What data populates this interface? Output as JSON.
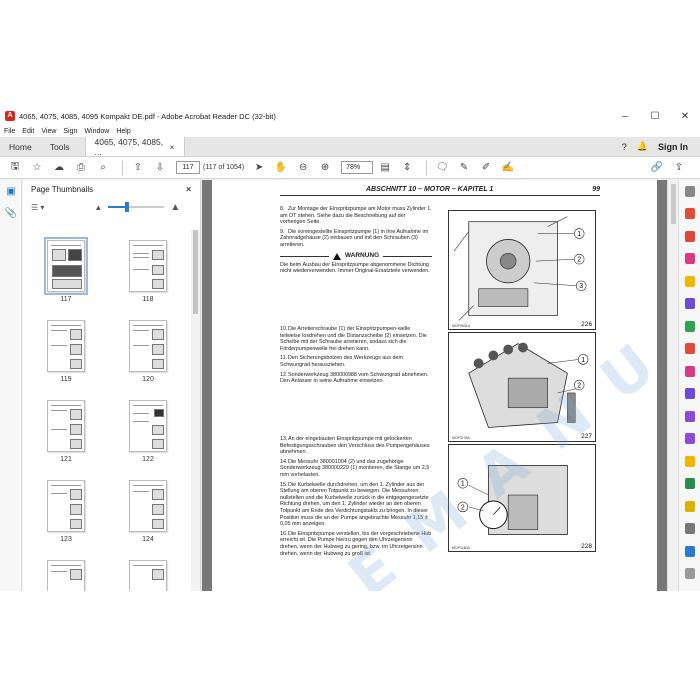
{
  "window": {
    "title": "4065, 4075, 4085, 4095 Kompakt DE.pdf - Adobe Acrobat Reader DC (32-bit)",
    "minimize": "–",
    "maximize": "☐",
    "close": "✕"
  },
  "menu": [
    "File",
    "Edit",
    "View",
    "Sign",
    "Window",
    "Help"
  ],
  "tabs": {
    "home": "Home",
    "tools": "Tools",
    "document": "4065, 4075, 4085, ...",
    "document_close": "×",
    "signin": "Sign In"
  },
  "toolbar": {
    "current_page": "117",
    "page_count": "(117 of 1054)",
    "zoom": "78%"
  },
  "thumbnails_panel": {
    "title": "Page Thumbnails",
    "close": "✕",
    "slider_level": 0.33,
    "pages": [
      "117",
      "118",
      "119",
      "120",
      "121",
      "122",
      "123",
      "124"
    ]
  },
  "document": {
    "header": "ABSCHNITT 10 – MOTOR – KAPITEL 1",
    "page_number": "99",
    "paragraphs_group1": [
      {
        "n": "8.",
        "text": "Zur Montage der Einspritzpumpe am Motor muss Zylinder 1 am OT stehen. Siehe dazu die Beschreibung auf der vorherigen Seite."
      },
      {
        "n": "9.",
        "text": "Die voreingestellte Einspritzpumpe (1) in ihre Aufnahme im Zahnradgehäuse (2) einbauen und mit den Schrauben (3) arretieren."
      }
    ],
    "warning_title": "WARNUNG",
    "warning_text": "Die beim Ausbau der Einspritzpumpe abgenommene Dichtung nicht wiederverwenden. Immer Original-Ersatzteile verwenden.",
    "paragraphs_group2": [
      {
        "n": "10.",
        "text": "Die Arretierschraube (1) der Einspritzpumpen-welle teilweise losdrehen und die Distanzscheibe (2) einsetzen. Die Scheibe mit der Schraube arretieren, sodass sich die Förderpumpenwelle frei drehen kann."
      },
      {
        "n": "11.",
        "text": "Den Sicherungsbolzen des Werkzeugs aus dem Schwungrad herausziehen."
      },
      {
        "n": "12.",
        "text": "Sonderwerkzeug 380000988 vom Schwungrad abnehmen. Den Anlasser in seine Aufnahme einsetzen."
      }
    ],
    "paragraphs_group3": [
      {
        "n": "13.",
        "text": "An der eingebauten Einspritzpumpe mit gelockerten Befestigungsschrauben den Verschluss des Pumpengehäuses abnehmen."
      },
      {
        "n": "14.",
        "text": "Die Messuhr 380001004 (2) und das zugehörige Sonderwerkzeug 380000229 (1) montieren, die Stange um 2,5 mm vorbelasten."
      },
      {
        "n": "15.",
        "text": "Die Kurbelwelle durchdrehen, um den 1. Zylinder aus der Stellung am oberen Totpunkt zu bewegen. Die Messuhren nullstellen und die Kurbelwelle zurück in die entgegengesetzte Richtung drehen, um den 1. Zylinder wieder an den oberen Totpunkt am Ende des Verdichtungstakts zu bringen. In dieser Position muss die an der Pumpe angebrachte Messuhr 1,15 ± 0,05 mm anzeigen."
      },
      {
        "n": "16.",
        "text": "Die Einspritzpumpe verstellen, bis der vorgeschriebene Hub erreicht ist. Die Pumpe hierzu gegen den Uhrzeigersinn drehen, wenn der Hubweg zu gering, bzw. im Uhrzeigersinn drehen, wenn der Hubweg zu groß ist."
      }
    ],
    "figures": [
      {
        "number": "226",
        "code": "MOP0831A",
        "callouts": [
          "1",
          "2",
          "3"
        ]
      },
      {
        "number": "227",
        "code": "MOP1176A",
        "callouts": [
          "1",
          "2"
        ]
      },
      {
        "number": "228",
        "code": "MOP1180A",
        "callouts": [
          "1",
          "2"
        ]
      }
    ],
    "watermark": "E M A N U A L"
  },
  "colors": {
    "accent": "#1a73c7",
    "app_icon": "#d8261f",
    "doc_background": "#777777"
  }
}
